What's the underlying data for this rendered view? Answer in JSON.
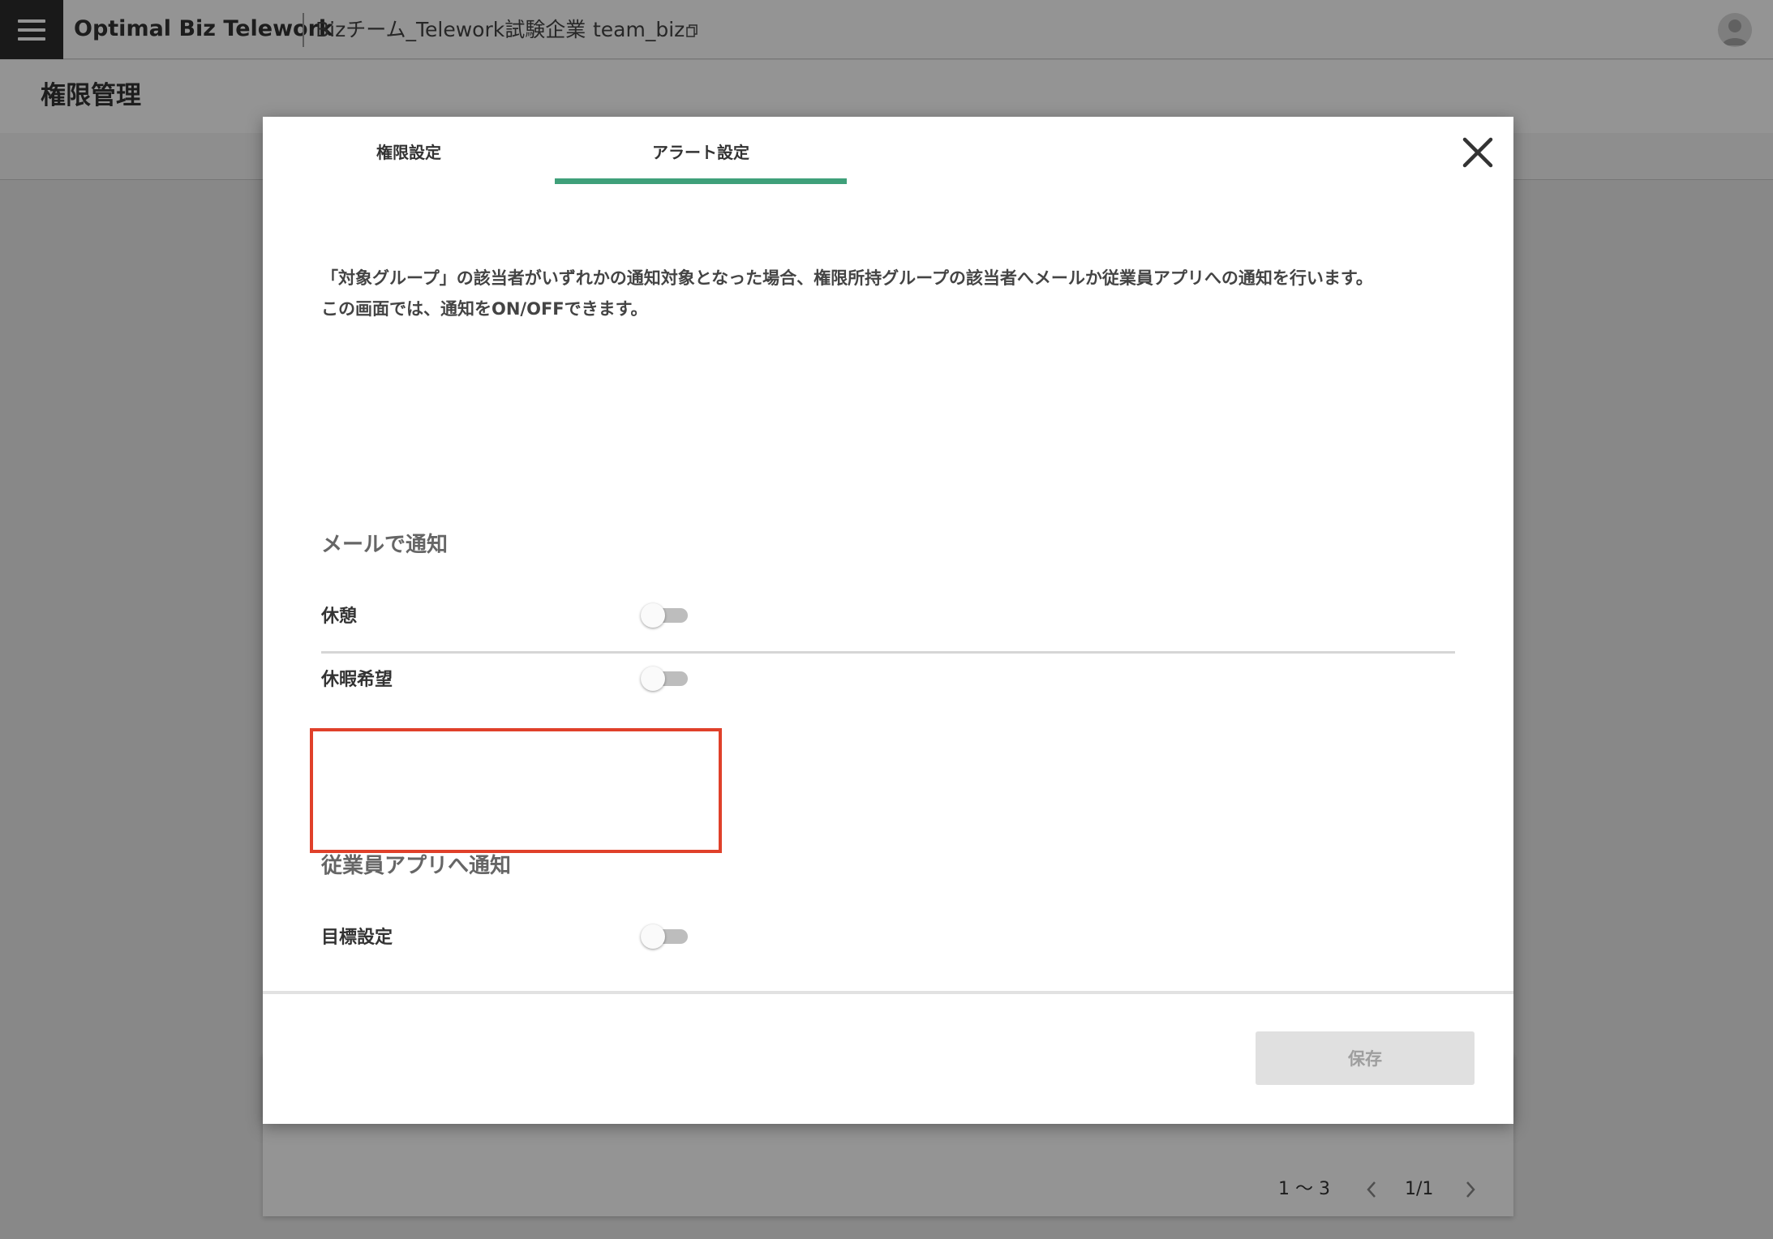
{
  "topbar": {
    "menu_icon": "hamburger-menu-icon",
    "app_title": "Optimal Biz Telework",
    "company_name": "Bizチーム_Telework試験企業",
    "team_id": "team_biz",
    "copy_icon": "copy-icon",
    "avatar_icon": "user-avatar-icon"
  },
  "page": {
    "title": "権限管理"
  },
  "pagination": {
    "range": "1 〜 3",
    "page": "1/1",
    "prev_icon": "chevron-left-icon",
    "next_icon": "chevron-right-icon"
  },
  "modal": {
    "tabs": [
      {
        "label": "権限設定",
        "active": false
      },
      {
        "label": "アラート設定",
        "active": true
      }
    ],
    "close_icon": "close-icon",
    "description": {
      "line1": "「対象グループ」の該当者がいずれかの通知対象となった場合、権限所持グループの該当者へメールか従業員アプリへの通知を行います。",
      "line2": "この画面では、通知をON/OFFできます。"
    },
    "mail_section": {
      "title": "メールで通知",
      "items": [
        {
          "label": "休憩",
          "enabled": false
        },
        {
          "label": "休暇希望",
          "enabled": false
        }
      ]
    },
    "app_section": {
      "title": "従業員アプリへ通知",
      "items": [
        {
          "label": "目標設定",
          "enabled": false
        }
      ]
    },
    "save_label": "保存"
  },
  "colors": {
    "accent": "#3fa07a",
    "highlight": "#e0402a",
    "menu_bg": "#2b2b2b",
    "toggle_off_track": "#bdbdbd",
    "save_disabled_bg": "#e0e0e0"
  }
}
